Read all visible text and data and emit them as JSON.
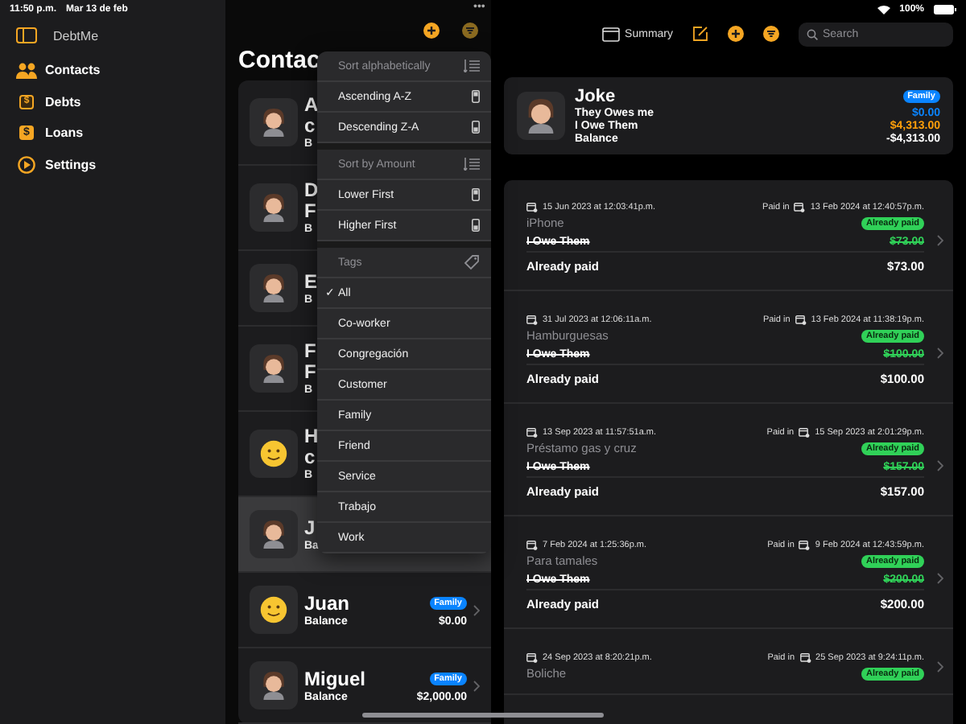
{
  "status_bar": {
    "time": "11:50 p.m.",
    "date": "Mar 13 de feb",
    "dots": "•••",
    "battery": "100%"
  },
  "sidebar": {
    "title": "DebtMe",
    "items": [
      {
        "label": "Contacts",
        "kind": "people"
      },
      {
        "label": "Debts",
        "kind": "outlined",
        "symbol": "$"
      },
      {
        "label": "Loans",
        "kind": "filled",
        "symbol": "$"
      },
      {
        "label": "Settings",
        "kind": "circle"
      }
    ]
  },
  "contacts": {
    "title": "Contac",
    "rows": [
      {
        "name_lines": [
          "A",
          "c"
        ],
        "balance_label": "B",
        "kind": "person",
        "selected": false
      },
      {
        "name_lines": [
          "D",
          "F"
        ],
        "balance_label": "B",
        "kind": "person",
        "selected": false
      },
      {
        "name_lines": [
          "E"
        ],
        "balance_label": "B",
        "kind": "person",
        "selected": false
      },
      {
        "name_lines": [
          "F",
          "F"
        ],
        "balance_label": "B",
        "kind": "person",
        "selected": false
      },
      {
        "name_lines": [
          "H",
          "c"
        ],
        "balance_label": "B",
        "kind": "smiley",
        "selected": false
      },
      {
        "name_lines": [
          "J"
        ],
        "balance_label": "Ba",
        "kind": "person",
        "selected": true
      },
      {
        "name_lines": [
          "Juan"
        ],
        "balance_label": "Balance",
        "amount": "$0.00",
        "tag": "Family",
        "kind": "smiley",
        "selected": false
      },
      {
        "name_lines": [
          "Miguel"
        ],
        "balance_label": "Balance",
        "amount": "$2,000.00",
        "tag": "Family",
        "kind": "person",
        "selected": false
      }
    ]
  },
  "menu": {
    "check_symbol": "✓",
    "sections": [
      {
        "header": "Sort alphabetically",
        "kind": "sort",
        "items": [
          {
            "label": "Ascending A-Z",
            "checked": false
          },
          {
            "label": "Descending Z-A",
            "checked": false
          }
        ]
      },
      {
        "header": "Sort by Amount",
        "kind": "sort",
        "items": [
          {
            "label": "Lower First",
            "checked": false
          },
          {
            "label": "Higher First",
            "checked": false
          }
        ]
      },
      {
        "header": "Tags",
        "kind": "tags",
        "items": [
          {
            "label": "All",
            "checked": true
          },
          {
            "label": "Co-worker",
            "checked": false
          },
          {
            "label": "Congregación",
            "checked": false
          },
          {
            "label": "Customer",
            "checked": false
          },
          {
            "label": "Family",
            "checked": false
          },
          {
            "label": "Friend",
            "checked": false
          },
          {
            "label": "Service",
            "checked": false
          },
          {
            "label": "Trabajo",
            "checked": false
          },
          {
            "label": "Work",
            "checked": false
          }
        ]
      }
    ]
  },
  "toolbar": {
    "summary": "Summary",
    "search_placeholder": "Search"
  },
  "detail": {
    "name": "Joke",
    "tag": "Family",
    "rows": [
      {
        "label": "They Owes me",
        "value": "$0.00",
        "color": "#0a84ff"
      },
      {
        "label": "I Owe Them",
        "value": "$4,313.00",
        "color": "#ff9f0a"
      },
      {
        "label": "Balance",
        "value": "-$4,313.00",
        "color": "#ffffff"
      }
    ]
  },
  "debts": [
    {
      "date": "15 Jun 2023 at 12:03:41p.m.",
      "paid_label": "Paid in",
      "paid_date": "13 Feb 2024 at 12:40:57p.m.",
      "title": "iPhone",
      "status": "Already paid",
      "paid": true,
      "owe_label": "I Owe Them",
      "owe_amount": "$73.00",
      "paid_row_label": "Already paid",
      "paid_amount": "$73.00"
    },
    {
      "date": "31 Jul 2023 at 12:06:11a.m.",
      "paid_label": "Paid in",
      "paid_date": "13 Feb 2024 at 11:38:19p.m.",
      "title": "Hamburguesas",
      "status": "Already paid",
      "paid": true,
      "owe_label": "I Owe Them",
      "owe_amount": "$100.00",
      "paid_row_label": "Already paid",
      "paid_amount": "$100.00"
    },
    {
      "date": "13 Sep 2023 at 11:57:51a.m.",
      "paid_label": "Paid in",
      "paid_date": "15 Sep 2023 at 2:01:29p.m.",
      "title": "Préstamo gas y cruz",
      "status": "Already paid",
      "paid": true,
      "owe_label": "I Owe Them",
      "owe_amount": "$157.00",
      "paid_row_label": "Already paid",
      "paid_amount": "$157.00"
    },
    {
      "date": "7 Feb 2024 at 1:25:36p.m.",
      "paid_label": "Paid in",
      "paid_date": "9 Feb 2024 at 12:43:59p.m.",
      "title": "Para tamales",
      "status": "Already paid",
      "paid": true,
      "owe_label": "I Owe Them",
      "owe_amount": "$200.00",
      "paid_row_label": "Already paid",
      "paid_amount": "$200.00"
    },
    {
      "date": "24 Sep 2023 at 8:20:21p.m.",
      "paid_label": "Paid in",
      "paid_date": "25 Sep 2023 at 9:24:11p.m.",
      "title": "Boliche",
      "status": "Already paid",
      "paid": true
    }
  ]
}
